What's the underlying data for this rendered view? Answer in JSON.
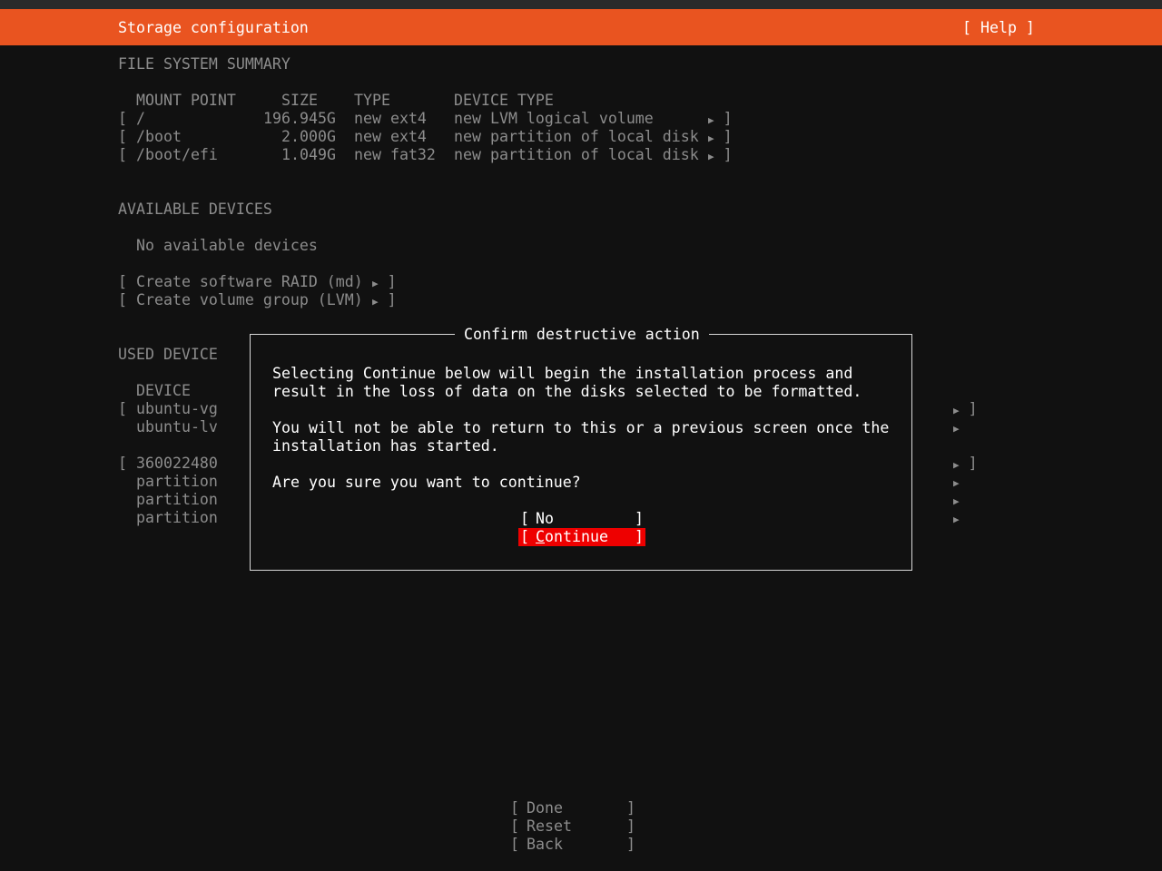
{
  "header": {
    "title": "Storage configuration",
    "help": "[ Help ]"
  },
  "filesystem_summary": {
    "heading": "FILE SYSTEM SUMMARY",
    "columns": [
      "MOUNT POINT",
      "SIZE",
      "TYPE",
      "DEVICE TYPE"
    ],
    "rows": [
      {
        "mount": "/",
        "size": "196.945G",
        "type": "new ext4",
        "device_type": "new LVM logical volume"
      },
      {
        "mount": "/boot",
        "size": "2.000G",
        "type": "new ext4",
        "device_type": "new partition of local disk"
      },
      {
        "mount": "/boot/efi",
        "size": "1.049G",
        "type": "new fat32",
        "device_type": "new partition of local disk"
      }
    ]
  },
  "available_devices": {
    "heading": "AVAILABLE DEVICES",
    "empty_text": "No available devices",
    "actions": [
      "Create software RAID (md)",
      "Create volume group (LVM)"
    ]
  },
  "used_devices": {
    "heading": "USED DEVICE",
    "column": "DEVICE",
    "rows": [
      "ubuntu-vg",
      "ubuntu-lv",
      "360022480",
      "partition",
      "partition",
      "partition"
    ]
  },
  "dialog": {
    "title": "Confirm destructive action",
    "line1": "Selecting Continue below will begin the installation process and",
    "line2": "result in the loss of data on the disks selected to be formatted.",
    "line3": "You will not be able to return to this or a previous screen once the",
    "line4": "installation has started.",
    "question": "Are you sure you want to continue?",
    "no_label": "No",
    "continue_first": "C",
    "continue_rest": "ontinue"
  },
  "footer": {
    "done": "Done",
    "reset": "Reset",
    "back": "Back"
  },
  "colors": {
    "header_bg": "#e95420",
    "selected_button_bg": "#ee0000",
    "background": "#111111"
  }
}
